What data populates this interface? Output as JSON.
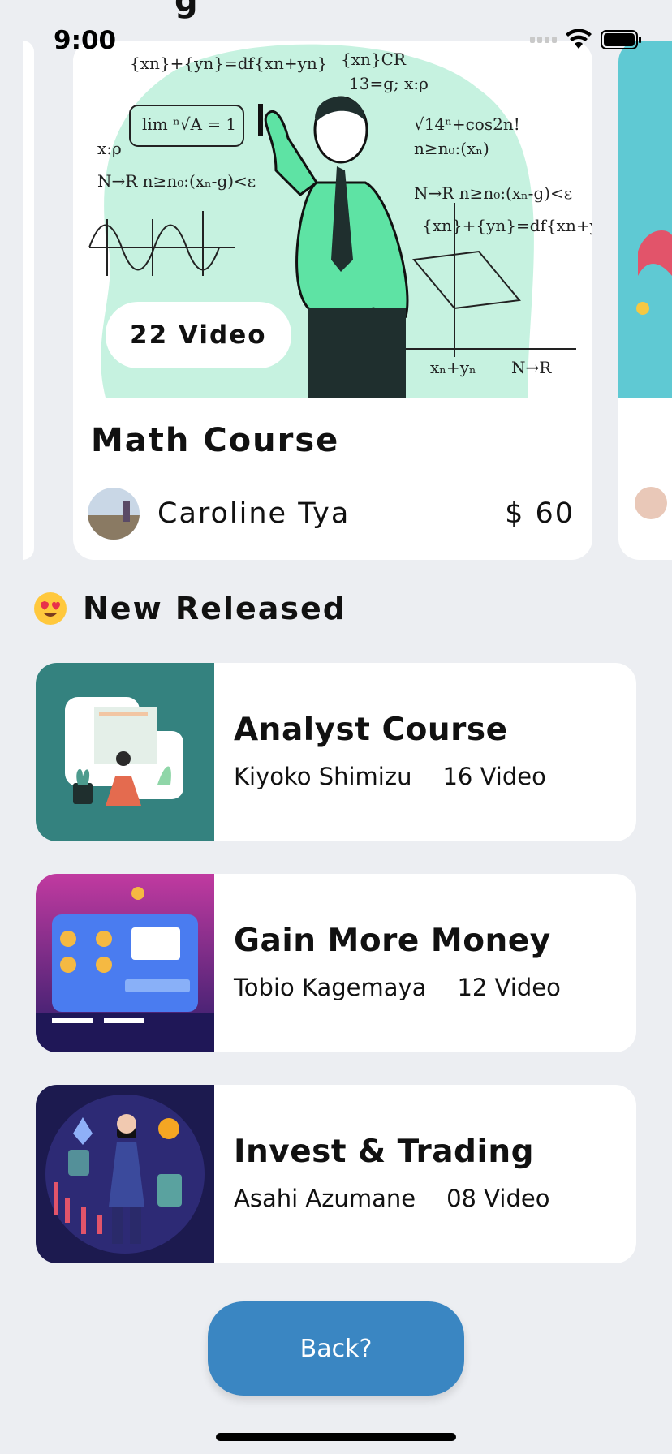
{
  "status_bar": {
    "time": "9:00"
  },
  "featured": {
    "video_count": "22 Video",
    "title": "Math Course",
    "author": "Caroline Tya",
    "price": "$ 60"
  },
  "section": {
    "title": "New Released"
  },
  "courses": [
    {
      "title": "Analyst Course",
      "author": "Kiyoko Shimizu",
      "videos": "16 Video"
    },
    {
      "title": "Gain More Money",
      "author": "Tobio Kagemaya",
      "videos": "12 Video"
    },
    {
      "title": "Invest & Trading",
      "author": "Asahi Azumane",
      "videos": "08 Video"
    }
  ],
  "back_button": {
    "label": "Back?"
  },
  "colors": {
    "background": "#eceef2",
    "accent": "#3a86c2",
    "mint": "#c6f2e0",
    "teal": "#34827f"
  }
}
